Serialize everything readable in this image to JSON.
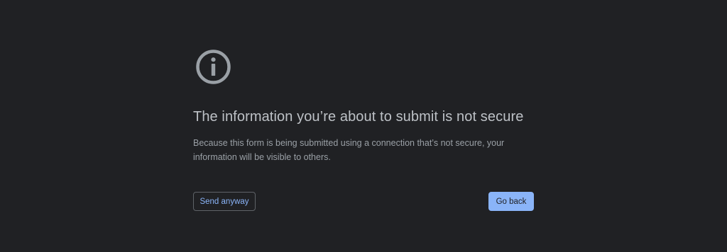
{
  "interstitial": {
    "icon": "info-circle-icon",
    "title": "The information you’re about to submit is not secure",
    "body": "Because this form is being submitted using a connection that’s not secure, your information will be visible to others.",
    "secondary_button_label": "Send anyway",
    "primary_button_label": "Go back"
  },
  "colors": {
    "background": "#202124",
    "icon": "#9aa0a6",
    "title_text": "#bdc1c6",
    "body_text": "#9aa0a6",
    "primary_button": "#8ab4f8",
    "secondary_button_text": "#8ab4f8",
    "secondary_button_border": "#5f6368"
  }
}
